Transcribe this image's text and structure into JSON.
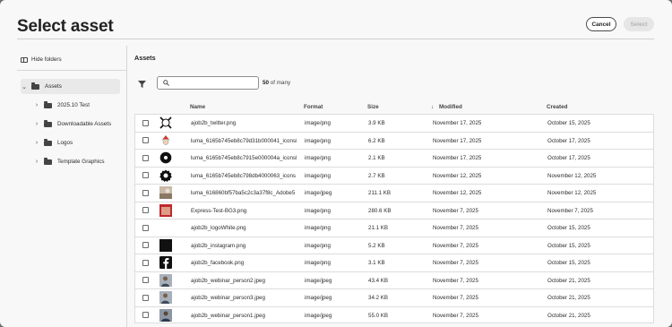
{
  "dialog": {
    "title": "Select asset",
    "cancel_label": "Cancel",
    "select_label": "Select"
  },
  "sidebar": {
    "hide_label": "Hide folders",
    "root": "Assets",
    "folders": [
      "2025.10 Test",
      "Downloadable Assets",
      "Logos",
      "Template Graphics"
    ]
  },
  "main": {
    "title": "Assets",
    "search_placeholder": "",
    "count_num": "50",
    "count_suffix": " of many",
    "columns": {
      "name": "Name",
      "format": "Format",
      "size": "Size",
      "modified": "Modified",
      "created": "Created",
      "sort_arrow": "↓"
    }
  },
  "assets": [
    {
      "name": "ajob2b_twitter.png",
      "format": "image/png",
      "size": "3.9 KB",
      "modified": "November 17, 2025",
      "created": "October 15, 2025",
      "thumb": "twitter"
    },
    {
      "name": "luma_6165b745eb8c79d31b000041_icons8",
      "format": "image/png",
      "size": "6.2 KB",
      "modified": "November 17, 2025",
      "created": "October 17, 2025",
      "thumb": "santa"
    },
    {
      "name": "luma_6165b745eb8c7915e000004a_iconsE",
      "format": "image/png",
      "size": "2.1 KB",
      "modified": "November 17, 2025",
      "created": "October 17, 2025",
      "thumb": "circle"
    },
    {
      "name": "luma_6165b745eb8c798db4000063_icons",
      "format": "image/png",
      "size": "2.7 KB",
      "modified": "November 12, 2025",
      "created": "November 12, 2025",
      "thumb": "badge"
    },
    {
      "name": "luma_616860bf57ba5c2c3a37f8c_Adobe5",
      "format": "image/jpeg",
      "size": "211.1 KB",
      "modified": "November 12, 2025",
      "created": "November 12, 2025",
      "thumb": "photo"
    },
    {
      "name": "Express-Test-BG3.png",
      "format": "image/png",
      "size": "280.6 KB",
      "modified": "November 7, 2025",
      "created": "November 7, 2025",
      "thumb": "red"
    },
    {
      "name": "ajob2b_logoWhite.png",
      "format": "image/png",
      "size": "21.1 KB",
      "modified": "November 7, 2025",
      "created": "October 15, 2025",
      "thumb": "blank"
    },
    {
      "name": "ajob2b_instagram.png",
      "format": "image/png",
      "size": "5.2 KB",
      "modified": "November 7, 2025",
      "created": "October 15, 2025",
      "thumb": "black"
    },
    {
      "name": "ajob2b_facebook.png",
      "format": "image/png",
      "size": "3.1 KB",
      "modified": "November 7, 2025",
      "created": "October 15, 2025",
      "thumb": "facebook"
    },
    {
      "name": "ajob2b_webinar_person2.jpeg",
      "format": "image/jpeg",
      "size": "43.4 KB",
      "modified": "November 7, 2025",
      "created": "October 21, 2025",
      "thumb": "person"
    },
    {
      "name": "ajob2b_webinar_person3.jpeg",
      "format": "image/jpeg",
      "size": "34.2 KB",
      "modified": "November 7, 2025",
      "created": "October 21, 2025",
      "thumb": "person"
    },
    {
      "name": "ajob2b_webinar_person1.jpeg",
      "format": "image/jpeg",
      "size": "55.0 KB",
      "modified": "November 7, 2025",
      "created": "October 21, 2025",
      "thumb": "person2"
    }
  ]
}
